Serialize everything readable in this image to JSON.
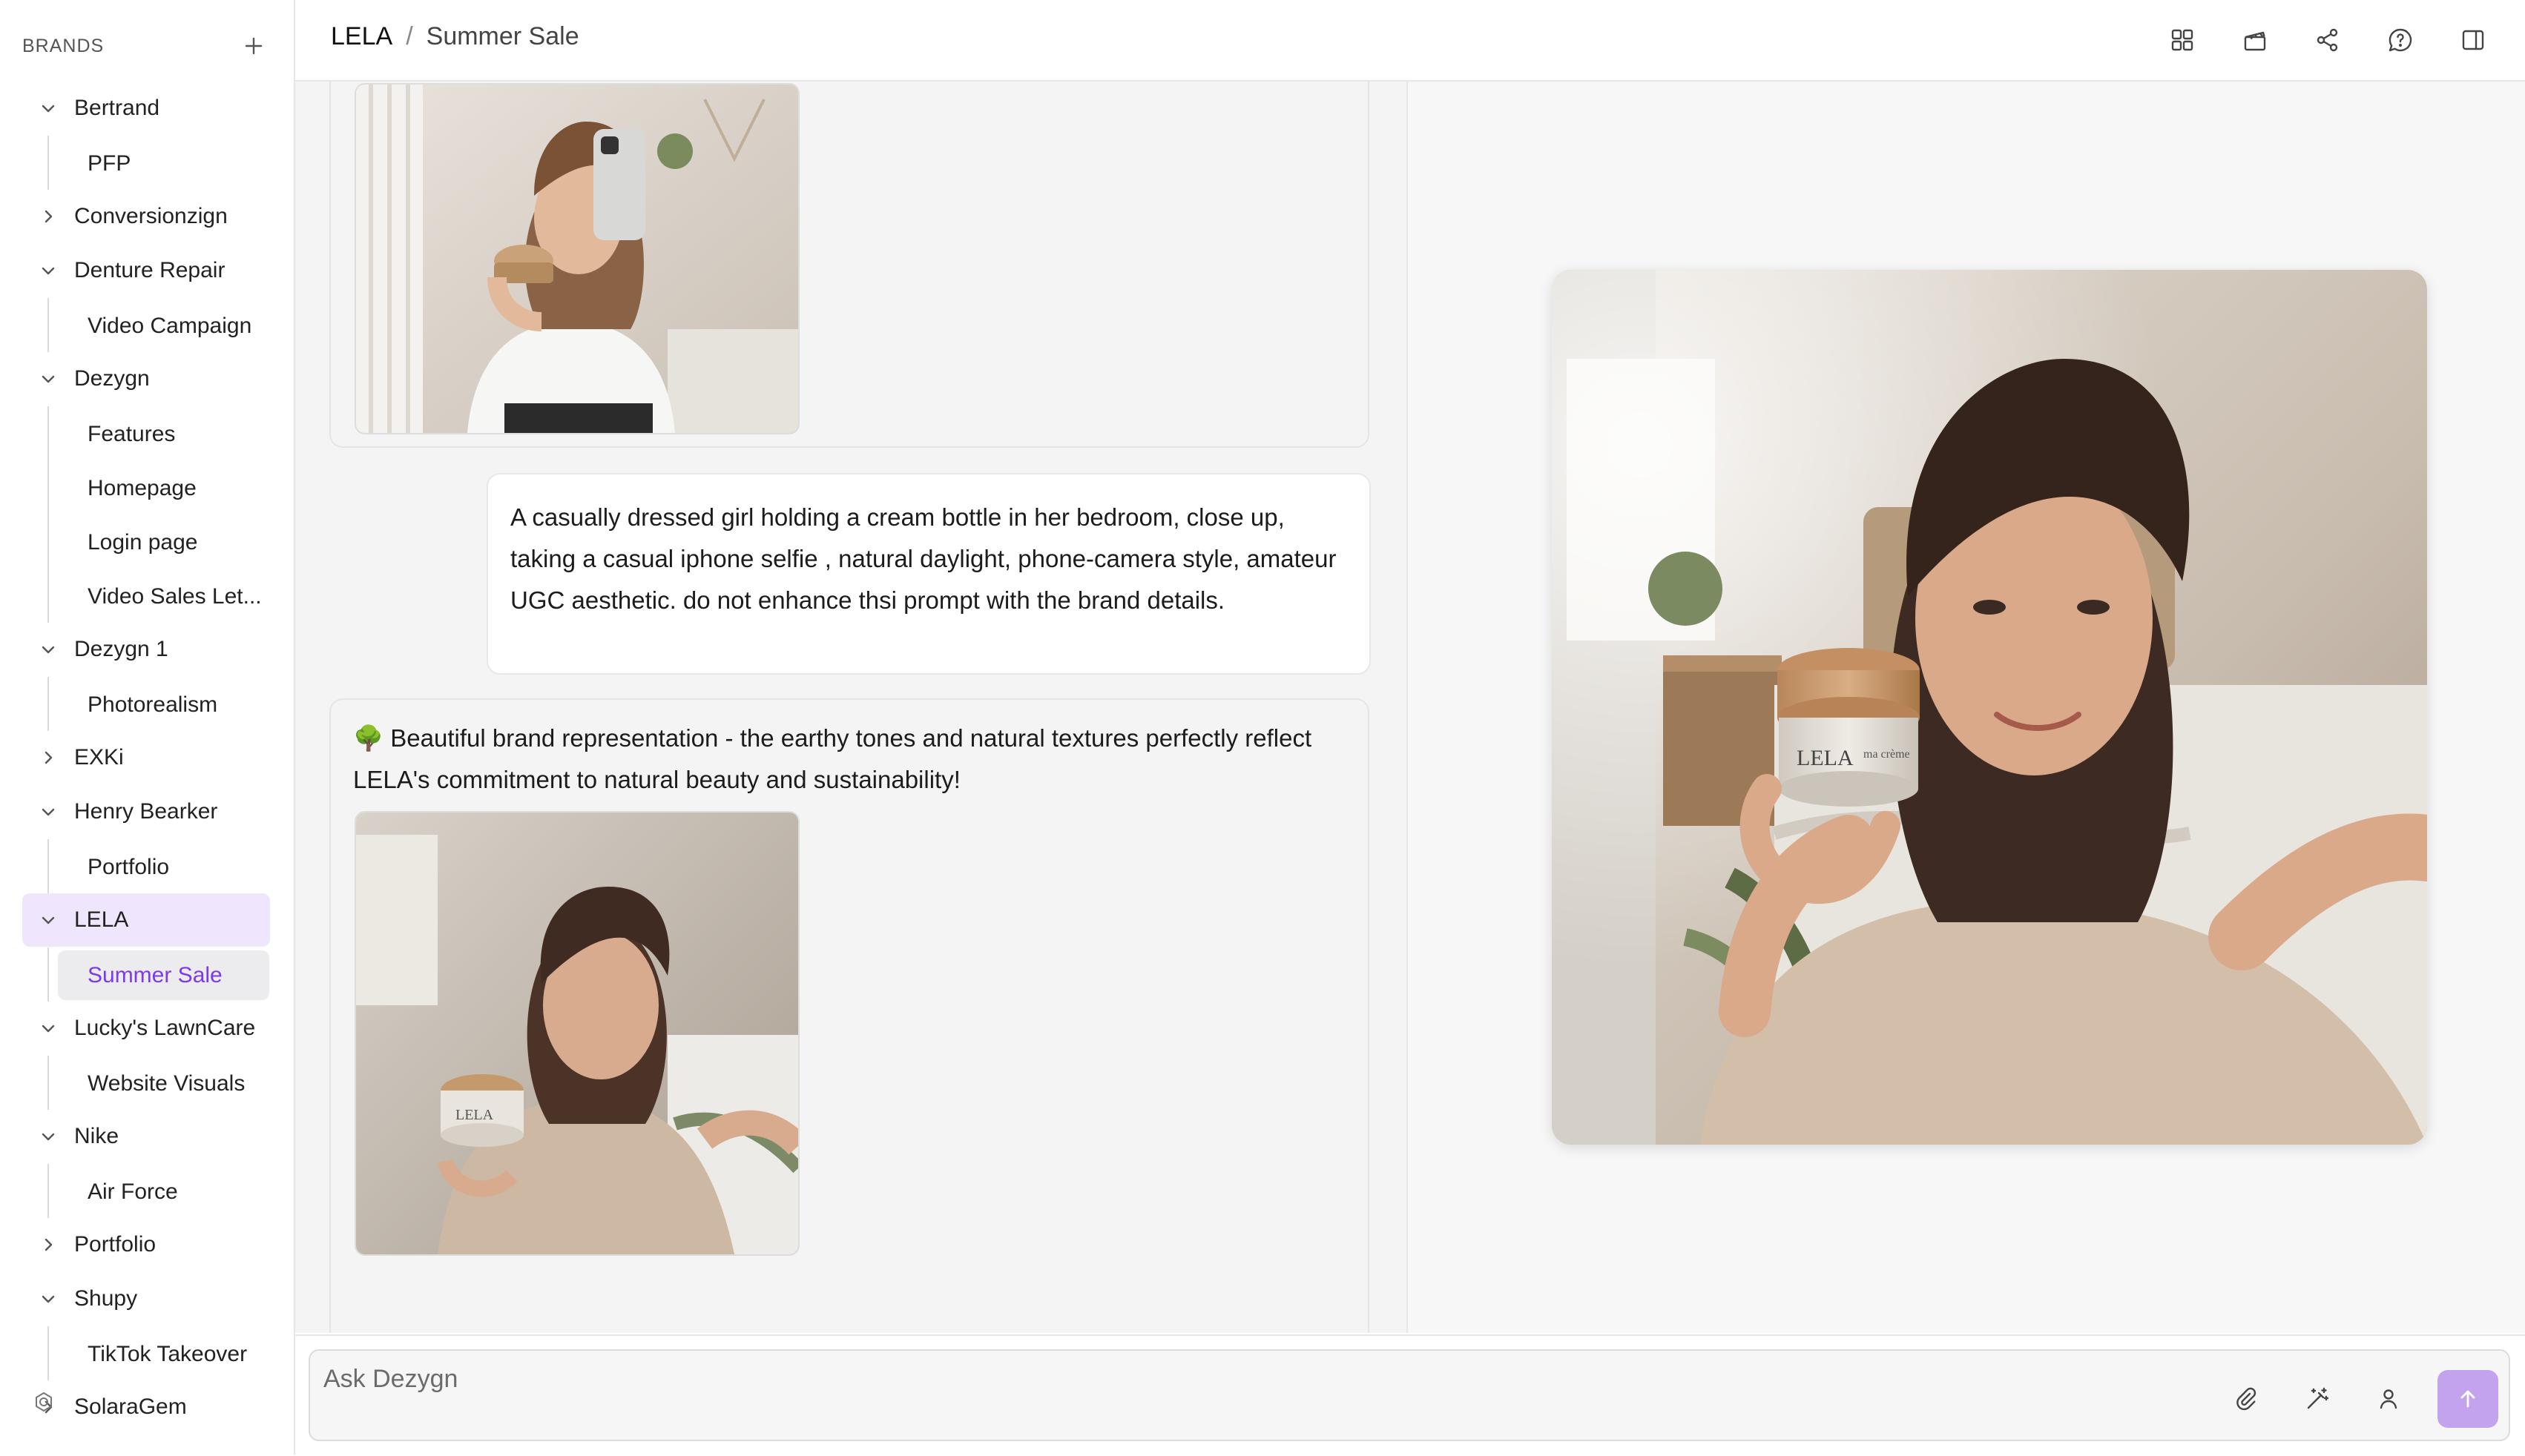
{
  "sidebar": {
    "header_label": "BRANDS",
    "brands": [
      {
        "name": "Bertrand",
        "expanded": true,
        "children": [
          "PFP"
        ]
      },
      {
        "name": "Conversionzign",
        "expanded": false,
        "children": []
      },
      {
        "name": "Denture Repair",
        "expanded": true,
        "children": [
          "Video Campaign"
        ]
      },
      {
        "name": "Dezygn",
        "expanded": true,
        "children": [
          "Features",
          "Homepage",
          "Login page",
          "Video Sales Let..."
        ]
      },
      {
        "name": "Dezygn 1",
        "expanded": true,
        "children": [
          "Photorealism"
        ]
      },
      {
        "name": "EXKi",
        "expanded": false,
        "children": []
      },
      {
        "name": "Henry Bearker",
        "expanded": true,
        "children": [
          "Portfolio"
        ]
      },
      {
        "name": "LELA",
        "expanded": true,
        "selected": true,
        "children": [
          "Summer Sale"
        ]
      },
      {
        "name": "Lucky's LawnCare",
        "expanded": true,
        "children": [
          "Website Visuals"
        ]
      },
      {
        "name": "Nike",
        "expanded": true,
        "children": [
          "Air Force"
        ]
      },
      {
        "name": "Portfolio",
        "expanded": false,
        "children": []
      },
      {
        "name": "Shupy",
        "expanded": true,
        "children": [
          "TikTok Takeover"
        ]
      },
      {
        "name": "SolaraGem",
        "expanded": false,
        "children": []
      }
    ],
    "selected_child": "Summer Sale"
  },
  "topbar": {
    "breadcrumb": {
      "brand": "LELA",
      "separator": "/",
      "project": "Summer Sale"
    },
    "icons": [
      "grid-icon",
      "film-clapper-icon",
      "share-icon",
      "help-chat-icon",
      "panel-toggle-icon"
    ]
  },
  "chat": {
    "messages": [
      {
        "role": "assistant",
        "image": "selfie-white-tshirt"
      },
      {
        "role": "user",
        "text": "A casually dressed girl holding a cream bottle in her bedroom, close up, taking a casual iphone selfie , natural daylight, phone-camera style, amateur UGC aesthetic. do not enhance thsi prompt with the brand details."
      },
      {
        "role": "assistant",
        "text": "🌳 Beautiful brand representation - the earthy tones and natural textures perfectly reflect LELA's commitment to natural beauty and sustainability!",
        "image": "woman-sweater-cream-jar"
      }
    ]
  },
  "preview": {
    "image": "woman-sweater-cream-jar",
    "jar_brand": "LELA",
    "jar_sub": "ma crème"
  },
  "composer": {
    "placeholder": "Ask Dezygn",
    "icons": [
      "paperclip-icon",
      "magic-wand-icon",
      "person-icon"
    ],
    "send_icon": "arrow-up-icon"
  },
  "colors": {
    "accent": "#7c3aed",
    "selected_brand_bg": "#efe6fd",
    "selected_child_bg": "#ececef",
    "send_button": "#c3a2ee"
  }
}
